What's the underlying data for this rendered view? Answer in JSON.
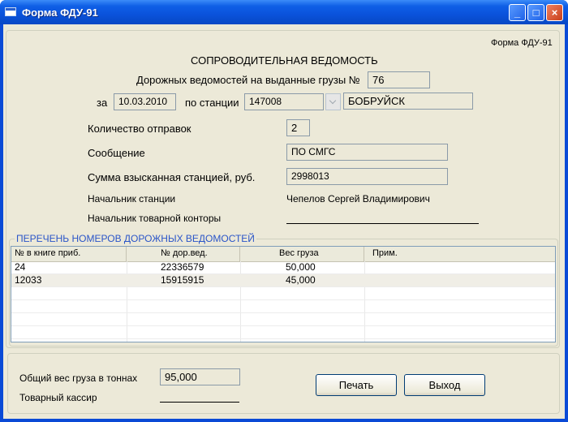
{
  "window": {
    "title": "Форма ФДУ-91",
    "minimize": "_",
    "maximize": "□",
    "close": "×"
  },
  "form": {
    "code_label": "Форма ФДУ-91",
    "heading": "СОПРОВОДИТЕЛЬНАЯ ВЕДОМОСТЬ",
    "subheading": "Дорожных ведомостей на выданные грузы №",
    "number": "76",
    "date_label": "за",
    "date": "10.03.2010",
    "station_label": "по станции",
    "station_code": "147008",
    "station_name": "БОБРУЙСК",
    "shipments_label": "Количество отправок",
    "shipments": "2",
    "message_label": "Сообщение",
    "message": "ПО СМГС",
    "sum_label": "Сумма взысканная станцией, руб.",
    "sum": "2998013",
    "chief_label": "Начальник станции",
    "chief": "Чепелов Сергей Владимирович",
    "office_chief_label": "Начальник товарной конторы"
  },
  "list": {
    "title": "ПЕРЕЧЕНЬ НОМЕРОВ ДОРОЖНЫХ ВЕДОМОСТЕЙ",
    "columns": [
      "№ в книге приб.",
      "№ дор.вед.",
      "Вес груза",
      "Прим."
    ],
    "rows": [
      {
        "book": "24",
        "doc": "22336579",
        "weight": "50,000",
        "note": ""
      },
      {
        "book": "12033",
        "doc": "15915915",
        "weight": "45,000",
        "note": ""
      }
    ]
  },
  "footer": {
    "total_label": "Общий вес груза в тоннах",
    "total": "95,000",
    "cashier_label": "Товарный кассир",
    "print": "Печать",
    "exit": "Выход"
  }
}
